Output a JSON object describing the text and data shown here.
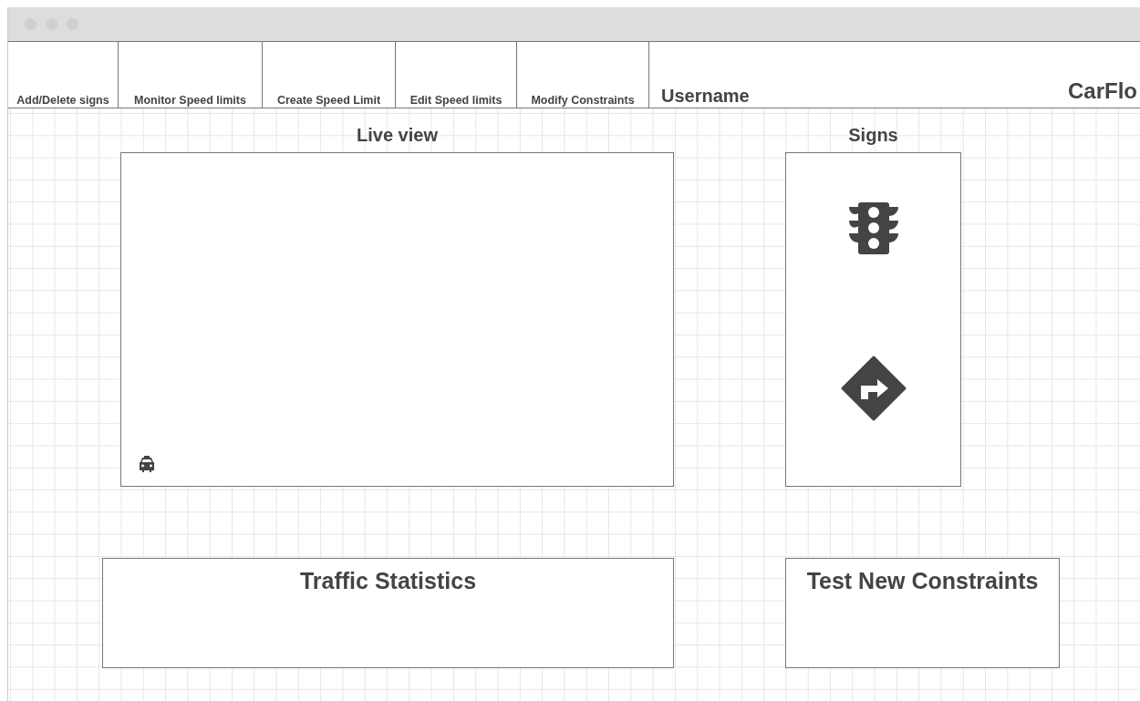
{
  "tabs": [
    {
      "label": "Add/Delete signs"
    },
    {
      "label": "Monitor Speed limits"
    },
    {
      "label": "Create Speed Limit"
    },
    {
      "label": "Edit Speed limits"
    },
    {
      "label": "Modify Constraints"
    }
  ],
  "username": "Username",
  "brand": "CarFlo",
  "live_view": {
    "title": "Live view"
  },
  "signs": {
    "title": "Signs"
  },
  "traffic_statistics": {
    "title": "Traffic Statistics"
  },
  "test_constraints": {
    "title": "Test New Constraints"
  }
}
